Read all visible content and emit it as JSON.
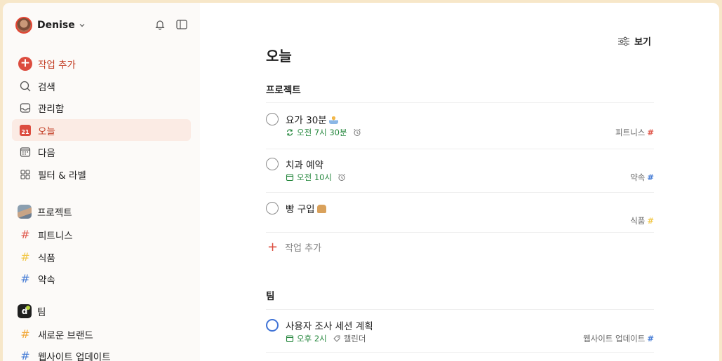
{
  "user": {
    "name": "Denise"
  },
  "nav": [
    {
      "label": "작업 추가",
      "icon": "add-circle-icon"
    },
    {
      "label": "검색",
      "icon": "search-icon"
    },
    {
      "label": "관리함",
      "icon": "inbox-icon"
    },
    {
      "label": "오늘",
      "icon": "today-calendar-icon",
      "active": true,
      "icon_text": "21"
    },
    {
      "label": "다음",
      "icon": "upcoming-calendar-icon"
    },
    {
      "label": "필터 & 라벨",
      "icon": "filters-grid-icon"
    }
  ],
  "projects_section": {
    "label": "프로젝트",
    "items": [
      {
        "label": "피트니스",
        "color": "#e05a4e"
      },
      {
        "label": "식품",
        "color": "#f2c94c"
      },
      {
        "label": "약속",
        "color": "#4a7fd6"
      }
    ]
  },
  "team_section": {
    "label": "팀",
    "avatar_letter": "d",
    "items": [
      {
        "label": "새로운 브랜드",
        "color": "#f2a93b"
      },
      {
        "label": "웹사이트 업데이트",
        "color": "#4a7fd6"
      }
    ]
  },
  "main": {
    "view_label": "보기",
    "title": "오늘",
    "groups": [
      {
        "title": "프로젝트",
        "tasks": [
          {
            "title": "요가 30분",
            "time": "오전 7시 30분",
            "time_icon": "recurring-icon",
            "has_alarm": true,
            "project": "피트니스",
            "project_color": "#e05a4e"
          },
          {
            "title": "치과 예약",
            "time": "오전 10시",
            "time_icon": "calendar-icon",
            "has_alarm": true,
            "project": "약속",
            "project_color": "#4a7fd6"
          },
          {
            "title": "빵 구입",
            "project": "식품",
            "project_color": "#f2c94c"
          }
        ],
        "add_label": "작업 추가"
      },
      {
        "title": "팀",
        "tasks": [
          {
            "title": "사용자 조사 세션 계획",
            "time": "오후 2시",
            "time_icon": "calendar-icon",
            "label": "캘린더",
            "project": "웹사이트 업데이트",
            "project_color": "#4a7fd6"
          }
        ]
      }
    ]
  },
  "hash_symbol": "#",
  "add_symbol": "+"
}
